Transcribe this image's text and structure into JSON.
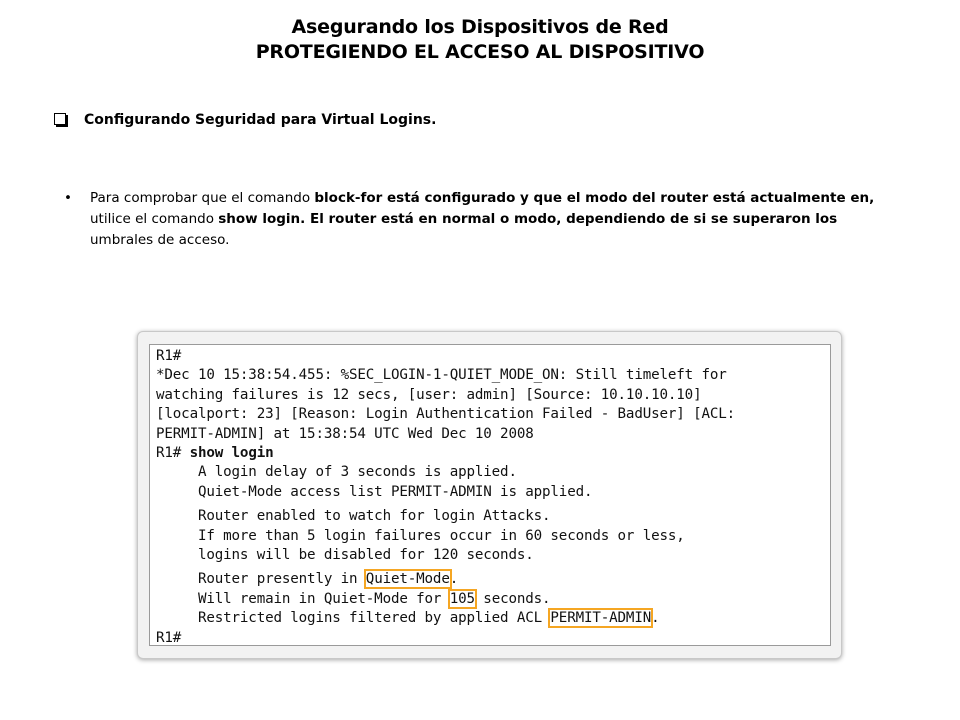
{
  "slide": {
    "title_line1": "Asegurando los Dispositivos de Red",
    "title_line2": "PROTEGIENDO EL ACCESO AL DISPOSITIVO",
    "subsection": "Configurando Seguridad para Virtual Logins.",
    "bullet_char": "•",
    "paragraph": {
      "t1": "Para comprobar que el comando ",
      "b1": "block-for está configurado y que el modo del router está actualmente en,",
      "t2": " utilice el comando ",
      "b2": "show login. El router está en normal o modo, dependiendo de si se superaron los",
      "t3": " umbrales de acceso."
    }
  },
  "terminal": {
    "l1": "R1#",
    "l2": "*Dec 10 15:38:54.455: %SEC_LOGIN-1-QUIET_MODE_ON: Still timeleft for",
    "l3": "watching failures is 12 secs, [user: admin] [Source: 10.10.10.10]",
    "l4": "[localport: 23] [Reason: Login Authentication Failed - BadUser] [ACL:",
    "l5": "PERMIT-ADMIN] at 15:38:54 UTC Wed Dec 10 2008",
    "prompt2": "R1# ",
    "cmd": "show login",
    "o1": "     A login delay of 3 seconds is applied.",
    "o2": "     Quiet-Mode access list PERMIT-ADMIN is applied.",
    "o3": "     Router enabled to watch for login Attacks.",
    "o4": "     If more than 5 login failures occur in 60 seconds or less,",
    "o5": "     logins will be disabled for 120 seconds.",
    "o6a": "     Router presently in ",
    "o6hl": "Quiet-Mode",
    "o6b": ".",
    "o7a": "     Will remain in Quiet-Mode for ",
    "o7hl": "105",
    "o7b": " seconds.",
    "o8a": "     Restricted logins filtered by applied ACL ",
    "o8hl": "PERMIT-ADMIN",
    "o8b": ".",
    "last": "R1#"
  },
  "colors": {
    "highlight": "#f5a623",
    "panel_bg": "#f2f2f2"
  }
}
